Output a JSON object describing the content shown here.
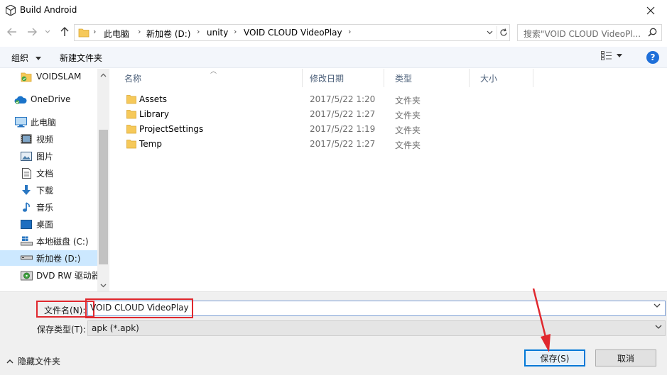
{
  "window": {
    "title": "Build Android"
  },
  "address": {
    "crumbs": [
      "此电脑",
      "新加卷 (D:)",
      "unity",
      "VOID CLOUD VideoPlay"
    ]
  },
  "search": {
    "placeholder": "搜索\"VOID CLOUD VideoPl..."
  },
  "toolbar": {
    "organize": "组织",
    "new_folder": "新建文件夹"
  },
  "sidebar": {
    "items": [
      {
        "label": "VOIDSLAM",
        "icon": "folder-check-icon"
      },
      {
        "label": "OneDrive",
        "icon": "cloud-icon"
      },
      {
        "label": "此电脑",
        "icon": "computer-icon"
      },
      {
        "label": "视频",
        "icon": "video-icon"
      },
      {
        "label": "图片",
        "icon": "picture-icon"
      },
      {
        "label": "文档",
        "icon": "document-icon"
      },
      {
        "label": "下载",
        "icon": "download-icon"
      },
      {
        "label": "音乐",
        "icon": "music-icon"
      },
      {
        "label": "桌面",
        "icon": "desktop-icon"
      },
      {
        "label": "本地磁盘 (C:)",
        "icon": "drive-icon"
      },
      {
        "label": "新加卷 (D:)",
        "icon": "drive-icon"
      },
      {
        "label": "DVD RW 驱动器",
        "icon": "dvd-icon"
      }
    ],
    "selected": "新加卷 (D:)"
  },
  "columns": {
    "name": "名称",
    "modified": "修改日期",
    "type": "类型",
    "size": "大小"
  },
  "files": [
    {
      "name": "Assets",
      "modified": "2017/5/22 1:20",
      "type": "文件夹"
    },
    {
      "name": "Library",
      "modified": "2017/5/22 1:27",
      "type": "文件夹"
    },
    {
      "name": "ProjectSettings",
      "modified": "2017/5/22 1:19",
      "type": "文件夹"
    },
    {
      "name": "Temp",
      "modified": "2017/5/22 1:27",
      "type": "文件夹"
    }
  ],
  "form": {
    "filename_label": "文件名(N):",
    "filename_value": "VOID CLOUD VideoPlay",
    "filetype_label": "保存类型(T):",
    "filetype_value": "apk (*.apk)"
  },
  "footer": {
    "hide_folders": "隐藏文件夹",
    "save": "保存(S)",
    "cancel": "取消"
  },
  "colors": {
    "accent": "#0078d7",
    "highlight": "#e0282e",
    "selected": "#cce8ff",
    "folder": "#f6c95a"
  }
}
